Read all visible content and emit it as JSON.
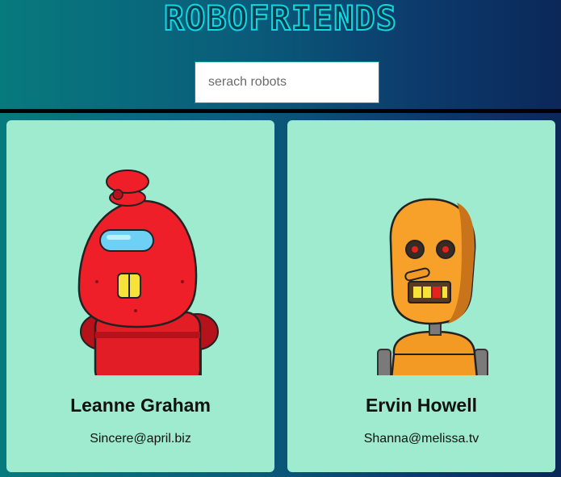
{
  "header": {
    "title": "ROBOFRIENDS"
  },
  "search": {
    "placeholder": "serach robots",
    "value": ""
  },
  "robots": [
    {
      "name": "Leanne Graham",
      "email": "Sincere@april.biz",
      "color": "#e8202a"
    },
    {
      "name": "Ervin Howell",
      "email": "Shanna@melissa.tv",
      "color": "#f39a24"
    }
  ],
  "colors": {
    "card_background": "#9eebd0",
    "title_accent": "#0fd8e3"
  }
}
